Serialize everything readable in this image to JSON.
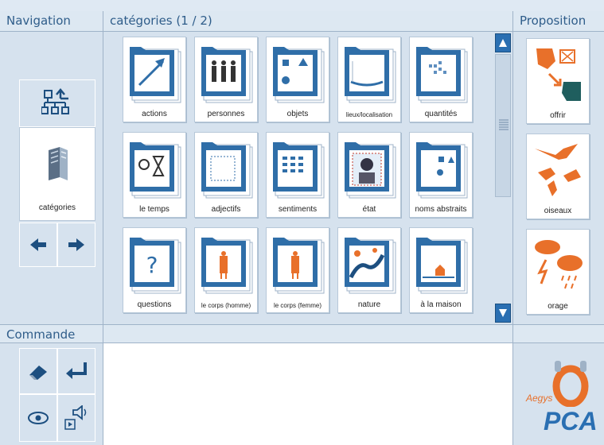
{
  "headers": {
    "navigation": "Navigation",
    "categories": "catégories (1 / 2)",
    "proposition": "Proposition",
    "commande": "Commande"
  },
  "nav": {
    "categories_label": "catégories"
  },
  "grid": {
    "rows": [
      [
        {
          "label": "actions",
          "small": false
        },
        {
          "label": "personnes",
          "small": false
        },
        {
          "label": "objets",
          "small": false
        },
        {
          "label": "lieux/localisation",
          "small": true
        },
        {
          "label": "quantités",
          "small": false
        }
      ],
      [
        {
          "label": "le temps",
          "small": false
        },
        {
          "label": "adjectifs",
          "small": false
        },
        {
          "label": "sentiments",
          "small": false
        },
        {
          "label": "état",
          "small": false
        },
        {
          "label": "noms abstraits",
          "small": false
        }
      ],
      [
        {
          "label": "questions",
          "small": false
        },
        {
          "label": "le corps (homme)",
          "small": true
        },
        {
          "label": "le corps (femme)",
          "small": true
        },
        {
          "label": "nature",
          "small": false
        },
        {
          "label": "à la maison",
          "small": false
        }
      ]
    ]
  },
  "propositions": [
    {
      "label": "offrir"
    },
    {
      "label": "oiseaux"
    },
    {
      "label": "orage"
    }
  ],
  "logo": {
    "brand": "Aegys",
    "product": "PCA"
  },
  "colors": {
    "accent": "#2a6fb2",
    "folder": "#2f6ea8",
    "orange": "#e8702a"
  }
}
